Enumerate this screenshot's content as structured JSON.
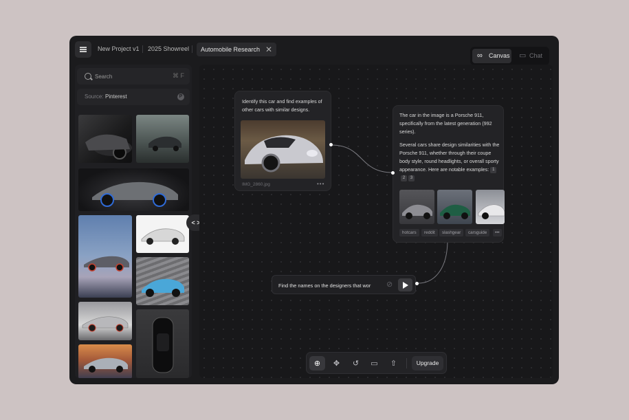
{
  "header": {
    "breadcrumbs": [
      "New Project v1",
      "2025 Showreel"
    ],
    "active_tab": "Automobile Research",
    "close_glyph": "✕",
    "menu_icon": "hamburger-menu-icon"
  },
  "mode_switch": {
    "canvas_label": "Canvas",
    "chat_label": "Chat",
    "active": "Canvas",
    "canvas_icon": "∞",
    "chat_icon": "▭"
  },
  "sidebar": {
    "search_placeholder": "Search",
    "search_shortcut": "⌘ F",
    "source_label": "Source:",
    "source_value": "Pinterest",
    "source_icon_glyph": "P"
  },
  "collapse_toggle": "< >",
  "prompt_node": {
    "text": "Identify this car and find examples of other cars with similar designs.",
    "filename": "IMG_2860.jpg",
    "more": "•••"
  },
  "response_node": {
    "paragraph1": "The car in the image is a Porsche 911, specifically from the latest generation (992 series).",
    "paragraph2": "Several cars share design similarities with the Porsche 911, whether through their coupe body style, round headlights, or overall sporty appearance. Here are notable examples:",
    "refs": [
      "1",
      "2",
      "3"
    ],
    "tags": [
      "hotcars",
      "reddit",
      "slashgear",
      "carsguide"
    ],
    "more": "•••"
  },
  "chat_input": {
    "value": "Find the names on the designers that wor"
  },
  "toolbar": {
    "tool_glyphs": [
      "⊕",
      "✥",
      "↺",
      "▭",
      "⇧"
    ],
    "upgrade_label": "Upgrade"
  },
  "colors": {
    "accent_white": "#ffffff",
    "canvas_bg": "#18181a",
    "window_bg": "#1b1b1d",
    "page_bg": "#cdc3c3"
  }
}
